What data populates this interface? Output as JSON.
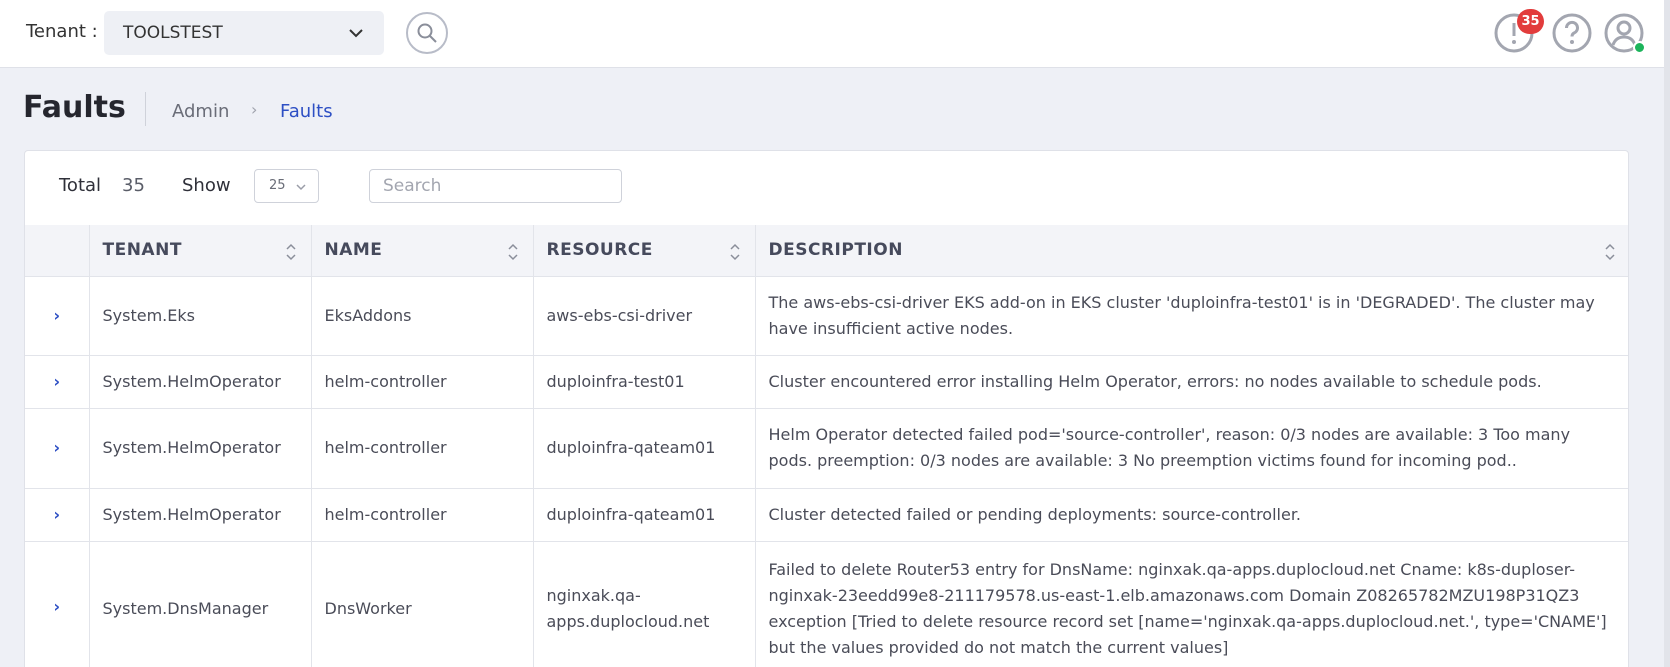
{
  "header": {
    "tenant_label": "Tenant :",
    "tenant_value": "TOOLSTEST",
    "fault_count": "35",
    "icons": {
      "search": "search-icon",
      "faults": "exclamation-circle-icon",
      "help": "question-circle-icon",
      "user": "user-circle-icon"
    }
  },
  "page": {
    "title": "Faults",
    "breadcrumb": [
      "Admin",
      "Faults"
    ],
    "breadcrumb_separator": "›"
  },
  "controls": {
    "total_label": "Total",
    "total_value": "35",
    "show_label": "Show",
    "show_value": "25",
    "search_placeholder": "Search"
  },
  "table": {
    "columns": [
      "TENANT",
      "NAME",
      "RESOURCE",
      "DESCRIPTION"
    ],
    "rows": [
      {
        "tenant": "System.Eks",
        "name": "EksAddons",
        "resource": "aws-ebs-csi-driver",
        "description": "The aws-ebs-csi-driver EKS add-on in EKS cluster 'duploinfra-test01' is in 'DEGRADED'. The cluster may have insufficient active nodes."
      },
      {
        "tenant": "System.HelmOperator",
        "name": "helm-controller",
        "resource": "duploinfra-test01",
        "description": "Cluster encountered error installing Helm Operator, errors: no nodes available to schedule pods."
      },
      {
        "tenant": "System.HelmOperator",
        "name": "helm-controller",
        "resource": "duploinfra-qateam01",
        "description": "Helm Operator detected failed pod='source-controller', reason: 0/3 nodes are available: 3 Too many pods. preemption: 0/3 nodes are available: 3 No preemption victims found for incoming pod.."
      },
      {
        "tenant": "System.HelmOperator",
        "name": "helm-controller",
        "resource": "duploinfra-qateam01",
        "description": "Cluster detected failed or pending deployments: source-controller."
      },
      {
        "tenant": "System.DnsManager",
        "name": "DnsWorker",
        "resource": "nginxak.qa-apps.duplocloud.net",
        "description": "Failed to delete Router53 entry for DnsName: nginxak.qa-apps.duplocloud.net Cname: k8s-duploser-nginxak-23eedd99e8-211179578.us-east-1.elb.amazonaws.com Domain Z08265782MZU198P31QZ3 exception [Tried to delete resource record set [name='nginxak.qa-apps.duplocloud.net.', type='CNAME'] but the values provided do not match the current values]"
      }
    ]
  },
  "colors": {
    "accent": "#2d4fc4",
    "badge": "#e23c3c",
    "online": "#1cb45b",
    "page_bg": "#eef0f6"
  }
}
